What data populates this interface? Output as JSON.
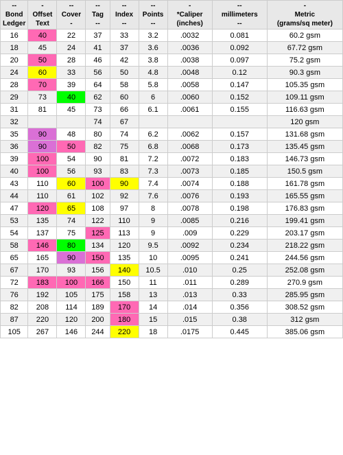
{
  "headers": {
    "row1": [
      "--",
      "-",
      "--",
      "--",
      "--",
      "--",
      "-",
      "--",
      "-"
    ],
    "row2": [
      "Bond\nLedger",
      "Offset\nText",
      "Cover\n-",
      "Tag\n--",
      "Index\n--",
      "Points\n--",
      "*Caliper\n(inches)",
      "millimeters\n--",
      "Metric\n(grams/sq meter)"
    ]
  },
  "rows": [
    {
      "bond": "16",
      "offset": "40",
      "cover": "22",
      "tag": "37",
      "index": "33",
      "points": "3.2",
      "caliper": ".0032",
      "mm": "0.081",
      "metric": "60.2 gsm",
      "offset_color": "pink",
      "cover_color": "",
      "tag_color": "",
      "index_color": ""
    },
    {
      "bond": "18",
      "offset": "45",
      "cover": "24",
      "tag": "41",
      "index": "37",
      "points": "3.6",
      "caliper": ".0036",
      "mm": "0.092",
      "metric": "67.72 gsm",
      "offset_color": "",
      "cover_color": "",
      "tag_color": "",
      "index_color": ""
    },
    {
      "bond": "20",
      "offset": "50",
      "cover": "28",
      "tag": "46",
      "index": "42",
      "points": "3.8",
      "caliper": ".0038",
      "mm": "0.097",
      "metric": "75.2 gsm",
      "offset_color": "pink",
      "cover_color": "",
      "tag_color": "",
      "index_color": ""
    },
    {
      "bond": "24",
      "offset": "60",
      "cover": "33",
      "tag": "56",
      "index": "50",
      "points": "4.8",
      "caliper": ".0048",
      "mm": "0.12",
      "metric": "90.3 gsm",
      "offset_color": "yellow",
      "cover_color": "",
      "tag_color": "",
      "index_color": ""
    },
    {
      "bond": "28",
      "offset": "70",
      "cover": "39",
      "tag": "64",
      "index": "58",
      "points": "5.8",
      "caliper": ".0058",
      "mm": "0.147",
      "metric": "105.35 gsm",
      "offset_color": "pink",
      "cover_color": "",
      "tag_color": "",
      "index_color": ""
    },
    {
      "bond": "29",
      "offset": "73",
      "cover": "40",
      "tag": "62",
      "index": "60",
      "points": "6",
      "caliper": ".0060",
      "mm": "0.152",
      "metric": "109.11 gsm",
      "offset_color": "",
      "cover_color": "green",
      "tag_color": "",
      "index_color": ""
    },
    {
      "bond": "31",
      "offset": "81",
      "cover": "45",
      "tag": "73",
      "index": "66",
      "points": "6.1",
      "caliper": ".0061",
      "mm": "0.155",
      "metric": "116.63 gsm",
      "offset_color": "",
      "cover_color": "",
      "tag_color": "",
      "index_color": ""
    },
    {
      "bond": "32",
      "offset": "",
      "cover": "",
      "tag": "74",
      "index": "67",
      "points": "",
      "caliper": "",
      "mm": "",
      "metric": "120 gsm",
      "offset_color": "",
      "cover_color": "",
      "tag_color": "",
      "index_color": ""
    },
    {
      "bond": "35",
      "offset": "90",
      "cover": "48",
      "tag": "80",
      "index": "74",
      "points": "6.2",
      "caliper": ".0062",
      "mm": "0.157",
      "metric": "131.68 gsm",
      "offset_color": "purple",
      "cover_color": "",
      "tag_color": "",
      "index_color": "",
      "row_color": "purple_row"
    },
    {
      "bond": "36",
      "offset": "90",
      "cover": "50",
      "tag": "82",
      "index": "75",
      "points": "6.8",
      "caliper": ".0068",
      "mm": "0.173",
      "metric": "135.45 gsm",
      "offset_color": "purple",
      "cover_color": "pink",
      "tag_color": "",
      "index_color": ""
    },
    {
      "bond": "39",
      "offset": "100",
      "cover": "54",
      "tag": "90",
      "index": "81",
      "points": "7.2",
      "caliper": ".0072",
      "mm": "0.183",
      "metric": "146.73 gsm",
      "offset_color": "pink",
      "cover_color": "",
      "tag_color": "",
      "index_color": ""
    },
    {
      "bond": "40",
      "offset": "100",
      "cover": "56",
      "tag": "93",
      "index": "83",
      "points": "7.3",
      "caliper": ".0073",
      "mm": "0.185",
      "metric": "150.5 gsm",
      "offset_color": "pink",
      "cover_color": "",
      "tag_color": "",
      "index_color": ""
    },
    {
      "bond": "43",
      "offset": "110",
      "cover": "60",
      "tag": "100",
      "index": "90",
      "points": "7.4",
      "caliper": ".0074",
      "mm": "0.188",
      "metric": "161.78 gsm",
      "offset_color": "",
      "cover_color": "yellow",
      "tag_color": "pink",
      "index_color": "yellow"
    },
    {
      "bond": "44",
      "offset": "110",
      "cover": "61",
      "tag": "102",
      "index": "92",
      "points": "7.6",
      "caliper": ".0076",
      "mm": "0.193",
      "metric": "165.55 gsm",
      "offset_color": "",
      "cover_color": "",
      "tag_color": "",
      "index_color": ""
    },
    {
      "bond": "47",
      "offset": "120",
      "cover": "65",
      "tag": "108",
      "index": "97",
      "points": "8",
      "caliper": ".0078",
      "mm": "0.198",
      "metric": "176.83 gsm",
      "offset_color": "pink",
      "cover_color": "yellow",
      "tag_color": "",
      "index_color": ""
    },
    {
      "bond": "53",
      "offset": "135",
      "cover": "74",
      "tag": "122",
      "index": "110",
      "points": "9",
      "caliper": ".0085",
      "mm": "0.216",
      "metric": "199.41 gsm",
      "offset_color": "",
      "cover_color": "",
      "tag_color": "",
      "index_color": ""
    },
    {
      "bond": "54",
      "offset": "137",
      "cover": "75",
      "tag": "125",
      "index": "113",
      "points": "9",
      "caliper": ".009",
      "mm": "0.229",
      "metric": "203.17 gsm",
      "offset_color": "",
      "cover_color": "",
      "tag_color": "pink",
      "index_color": ""
    },
    {
      "bond": "58",
      "offset": "146",
      "cover": "80",
      "tag": "134",
      "index": "120",
      "points": "9.5",
      "caliper": ".0092",
      "mm": "0.234",
      "metric": "218.22 gsm",
      "offset_color": "pink",
      "cover_color": "green",
      "tag_color": "",
      "index_color": ""
    },
    {
      "bond": "65",
      "offset": "165",
      "cover": "90",
      "tag": "150",
      "index": "135",
      "points": "10",
      "caliper": ".0095",
      "mm": "0.241",
      "metric": "244.56 gsm",
      "offset_color": "",
      "cover_color": "purple",
      "tag_color": "pink",
      "index_color": ""
    },
    {
      "bond": "67",
      "offset": "170",
      "cover": "93",
      "tag": "156",
      "index": "140",
      "points": "10.5",
      "caliper": ".010",
      "mm": "0.25",
      "metric": "252.08 gsm",
      "offset_color": "",
      "cover_color": "",
      "tag_color": "",
      "index_color": "yellow"
    },
    {
      "bond": "72",
      "offset": "183",
      "cover": "100",
      "tag": "166",
      "index": "150",
      "points": "11",
      "caliper": ".011",
      "mm": "0.289",
      "metric": "270.9 gsm",
      "offset_color": "pink",
      "cover_color": "pink",
      "tag_color": "pink",
      "index_color": ""
    },
    {
      "bond": "76",
      "offset": "192",
      "cover": "105",
      "tag": "175",
      "index": "158",
      "points": "13",
      "caliper": ".013",
      "mm": "0.33",
      "metric": "285.95 gsm",
      "offset_color": "",
      "cover_color": "",
      "tag_color": "",
      "index_color": ""
    },
    {
      "bond": "82",
      "offset": "208",
      "cover": "114",
      "tag": "189",
      "index": "170",
      "points": "14",
      "caliper": ".014",
      "mm": "0.356",
      "metric": "308.52 gsm",
      "offset_color": "",
      "cover_color": "",
      "tag_color": "",
      "index_color": "pink"
    },
    {
      "bond": "87",
      "offset": "220",
      "cover": "120",
      "tag": "200",
      "index": "180",
      "points": "15",
      "caliper": ".015",
      "mm": "0.38",
      "metric": "312 gsm",
      "offset_color": "",
      "cover_color": "",
      "tag_color": "",
      "index_color": "pink"
    },
    {
      "bond": "105",
      "offset": "267",
      "cover": "146",
      "tag": "244",
      "index": "220",
      "points": "18",
      "caliper": ".0175",
      "mm": "0.445",
      "metric": "385.06 gsm",
      "offset_color": "",
      "cover_color": "",
      "tag_color": "",
      "index_color": "yellow"
    }
  ]
}
